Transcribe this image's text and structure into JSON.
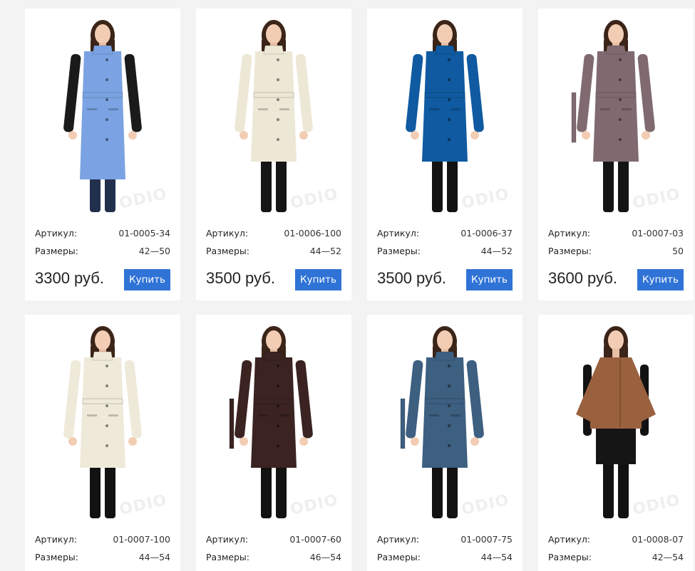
{
  "labels": {
    "article": "Артикул:",
    "sizes": "Размеры:",
    "buy": "Купить",
    "watermark": "ODIO"
  },
  "products": [
    {
      "article": "01-0005-34",
      "sizes": "42—50",
      "price": "3300 руб.",
      "coat_color": "#7ba3e3",
      "sleeve_color": "#1a1a1a",
      "pants_color": "#22304d",
      "style": "vest"
    },
    {
      "article": "01-0006-100",
      "sizes": "44—52",
      "price": "3500 руб.",
      "coat_color": "#ede7d6",
      "sleeve_color": "#ede7d6",
      "pants_color": "#151515",
      "style": "coat"
    },
    {
      "article": "01-0006-37",
      "sizes": "44—52",
      "price": "3500 руб.",
      "coat_color": "#0f5aa0",
      "sleeve_color": "#0f5aa0",
      "pants_color": "#121212",
      "style": "coat"
    },
    {
      "article": "01-0007-03",
      "sizes": "50",
      "price": "3600 руб.",
      "coat_color": "#806a70",
      "sleeve_color": "#806a70",
      "pants_color": "#141414",
      "style": "coat-belt"
    },
    {
      "article": "01-0007-100",
      "sizes": "44—54",
      "price": "",
      "coat_color": "#eee9d9",
      "sleeve_color": "#eee9d9",
      "pants_color": "#121212",
      "style": "coat"
    },
    {
      "article": "01-0007-60",
      "sizes": "46—54",
      "price": "",
      "coat_color": "#3a2321",
      "sleeve_color": "#3a2321",
      "pants_color": "#121212",
      "style": "coat-belt"
    },
    {
      "article": "01-0007-75",
      "sizes": "44—54",
      "price": "",
      "coat_color": "#3d5f80",
      "sleeve_color": "#3d5f80",
      "pants_color": "#121212",
      "style": "coat-belt"
    },
    {
      "article": "01-0008-07",
      "sizes": "42—54",
      "price": "",
      "coat_color": "#9a613f",
      "sleeve_color": "#121212",
      "pants_color": "#121212",
      "style": "cape"
    }
  ]
}
